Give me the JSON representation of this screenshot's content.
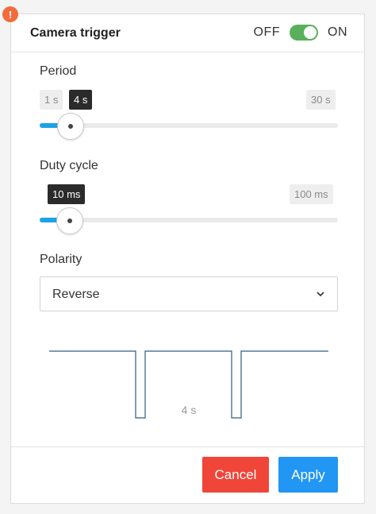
{
  "alert_badge": "!",
  "header": {
    "title": "Camera trigger",
    "toggle_off": "OFF",
    "toggle_on": "ON",
    "toggle_state": true
  },
  "period": {
    "label": "Period",
    "min_label": "1 s",
    "value_label": "4 s",
    "max_label": "30 s",
    "fraction": 0.103
  },
  "duty_cycle": {
    "label": "Duty cycle",
    "value_label": "10 ms",
    "max_label": "100 ms",
    "fraction": 0.1
  },
  "polarity": {
    "label": "Polarity",
    "selected": "Reverse"
  },
  "waveform": {
    "period_label": "4 s"
  },
  "footer": {
    "cancel_label": "Cancel",
    "apply_label": "Apply"
  },
  "colors": {
    "accent": "#1aa3e8",
    "toggle_on": "#5ab05a",
    "cancel": "#f0463a",
    "apply": "#2196f3",
    "alert": "#f26c3d",
    "waveform": "#2d5c8a"
  }
}
